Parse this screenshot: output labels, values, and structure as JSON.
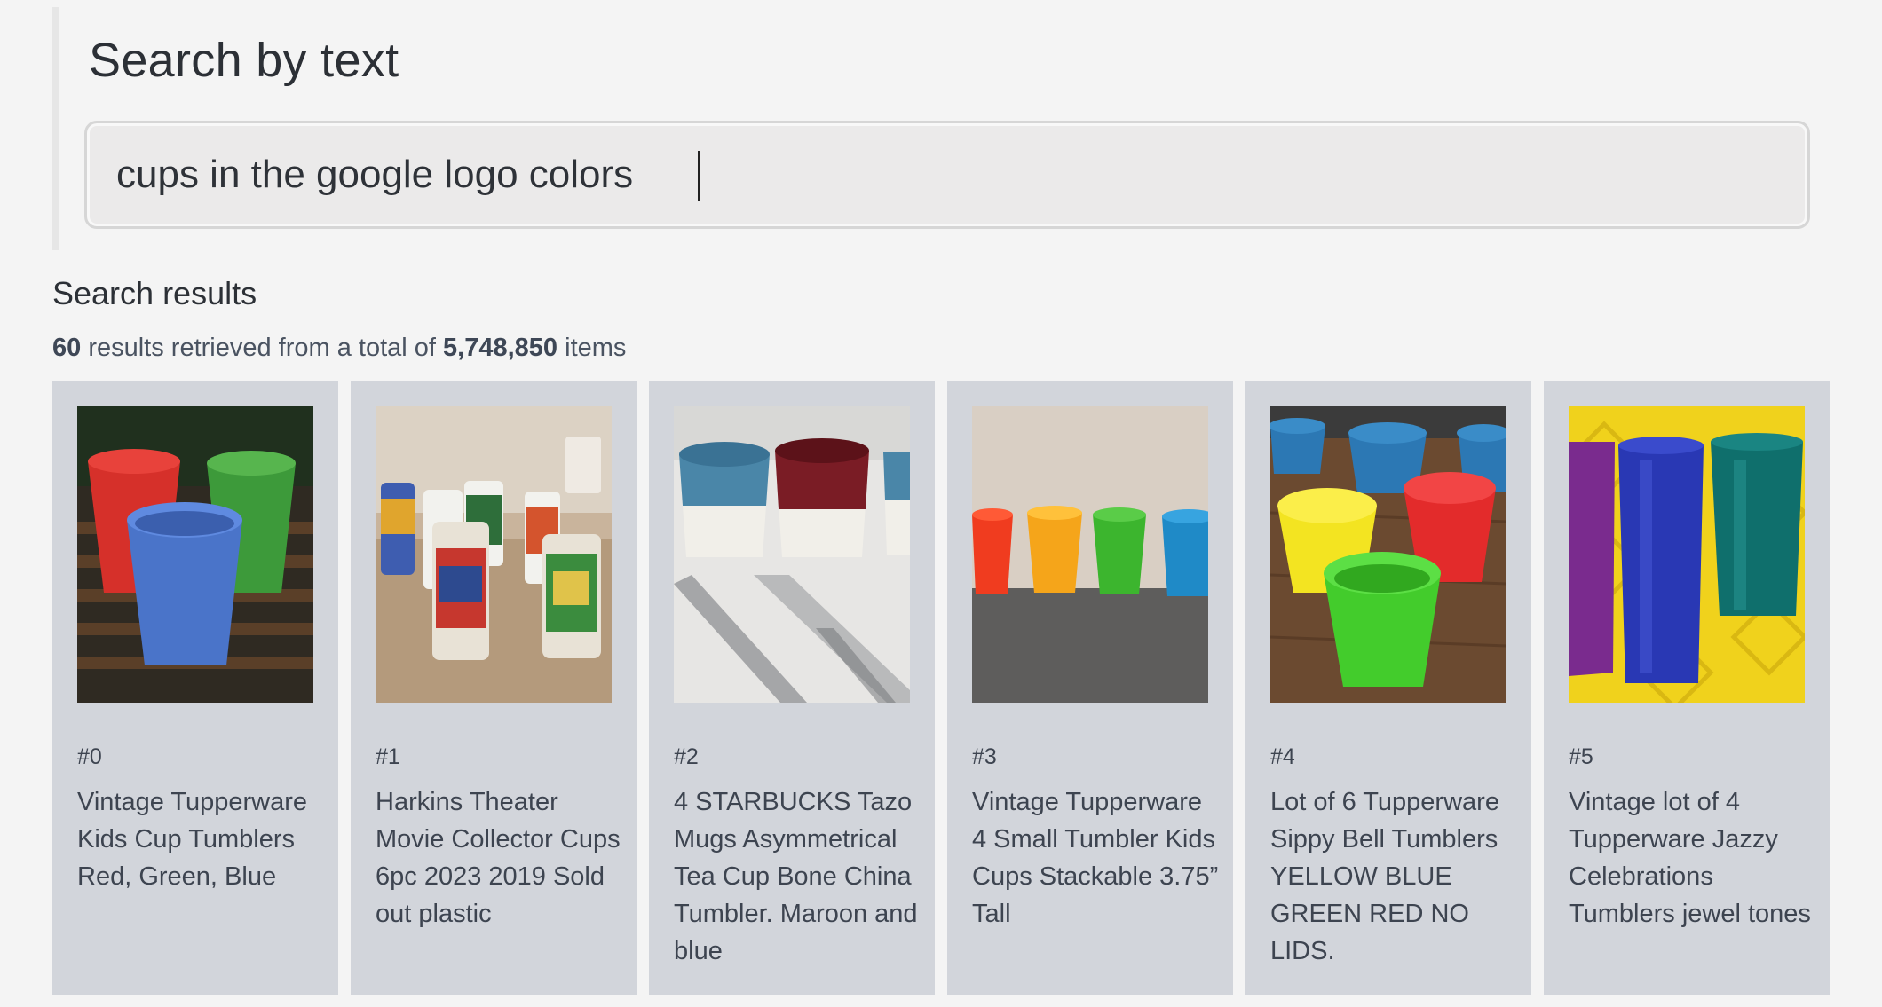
{
  "search": {
    "heading": "Search by text",
    "query": "cups in the google logo colors"
  },
  "results": {
    "title": "Search results",
    "count": "60",
    "summary_middle": " results retrieved from a total of ",
    "total": "5,748,850",
    "summary_end": " items",
    "items": [
      {
        "rank": "#0",
        "title": "Vintage Tupperware Kids Cup Tumblers Red, Green, Blue"
      },
      {
        "rank": "#1",
        "title": "Harkins Theater Movie Collector Cups 6pc 2023 2019 Sold out plastic"
      },
      {
        "rank": "#2",
        "title": "4 STARBUCKS Tazo Mugs Asymmetrical Tea Cup Bone China Tumbler. Maroon and blue"
      },
      {
        "rank": "#3",
        "title": "Vintage Tupperware 4 Small Tumbler Kids Cups Stackable 3.75” Tall"
      },
      {
        "rank": "#4",
        "title": "Lot of 6 Tupperware Sippy Bell Tumblers YELLOW BLUE GREEN RED NO LIDS."
      },
      {
        "rank": "#5",
        "title": "Vintage lot of 4 Tupperware Jazzy Celebrations Tumblers jewel tones"
      }
    ]
  }
}
